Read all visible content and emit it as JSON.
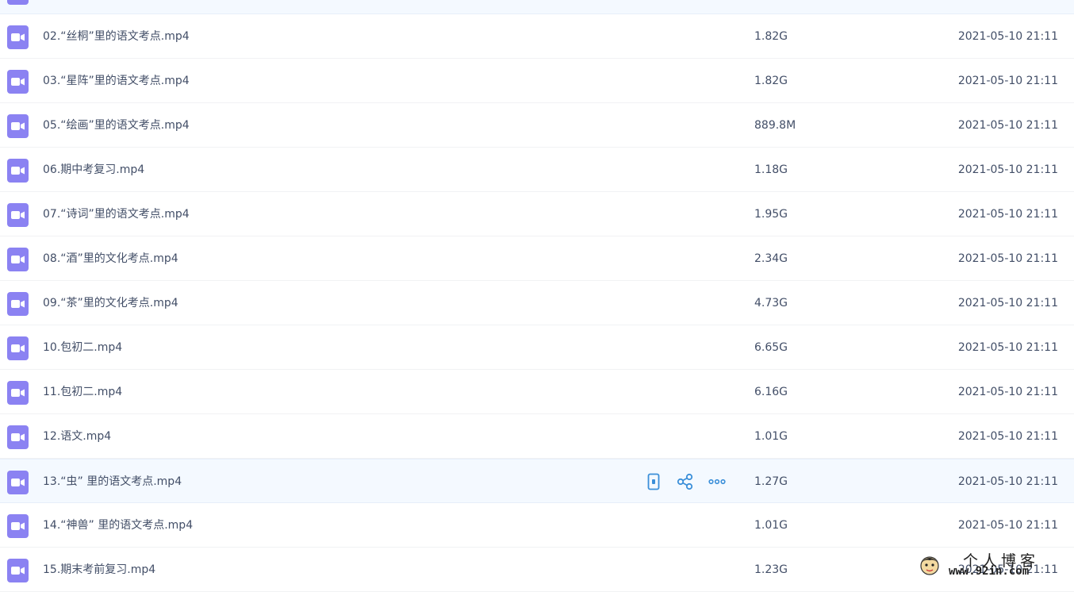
{
  "colors": {
    "icon_bg": "#8b82f2",
    "action_blue": "#3b8fd9",
    "hover_bg": "#f4f9ff",
    "text": "#424e67"
  },
  "files": [
    {
      "name": "",
      "size": "",
      "date": "",
      "style": "top"
    },
    {
      "name": "02.“丝桐”里的语文考点.mp4",
      "size": "1.82G",
      "date": "2021-05-10 21:11"
    },
    {
      "name": "03.“星阵”里的语文考点.mp4",
      "size": "1.82G",
      "date": "2021-05-10 21:11"
    },
    {
      "name": "05.“绘画”里的语文考点.mp4",
      "size": "889.8M",
      "date": "2021-05-10 21:11"
    },
    {
      "name": "06.期中考复习.mp4",
      "size": "1.18G",
      "date": "2021-05-10 21:11"
    },
    {
      "name": "07.“诗词”里的语文考点.mp4",
      "size": "1.95G",
      "date": "2021-05-10 21:11"
    },
    {
      "name": "08.“酒”里的文化考点.mp4",
      "size": "2.34G",
      "date": "2021-05-10 21:11"
    },
    {
      "name": "09.“茶”里的文化考点.mp4",
      "size": "4.73G",
      "date": "2021-05-10 21:11"
    },
    {
      "name": "10.包初二.mp4",
      "size": "6.65G",
      "date": "2021-05-10 21:11"
    },
    {
      "name": "11.包初二.mp4",
      "size": "6.16G",
      "date": "2021-05-10 21:11"
    },
    {
      "name": "12.语文.mp4",
      "size": "1.01G",
      "date": "2021-05-10 21:11"
    },
    {
      "name": "13.“虫” 里的语文考点.mp4",
      "size": "1.27G",
      "date": "2021-05-10 21:11",
      "style": "hover"
    },
    {
      "name": "14.“神兽” 里的语文考点.mp4",
      "size": "1.01G",
      "date": "2021-05-10 21:11"
    },
    {
      "name": "15.期末考前复习.mp4",
      "size": "1.23G",
      "date": "2021-05-10 21:11"
    }
  ],
  "row_actions": [
    {
      "icon": "phone-icon"
    },
    {
      "icon": "share-icon"
    },
    {
      "icon": "more-icon"
    }
  ],
  "watermark": {
    "title": "个人博客",
    "url": "www.92in.com"
  }
}
